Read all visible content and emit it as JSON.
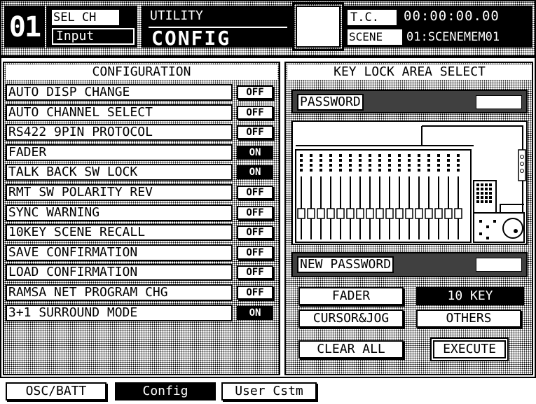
{
  "header": {
    "channel_number": "01",
    "sel_ch_label": "SEL CH",
    "sel_ch_value": "Input",
    "mode_label": "UTILITY",
    "mode_value": "CONFIG",
    "tc_label": "T.C.",
    "tc_value": "00:00:00.00",
    "scene_label": "SCENE",
    "scene_value": "01:SCENEMEM01"
  },
  "configuration": {
    "title": "CONFIGURATION",
    "items": [
      {
        "label": "AUTO DISP CHANGE",
        "state": "OFF"
      },
      {
        "label": "AUTO CHANNEL SELECT",
        "state": "OFF"
      },
      {
        "label": "RS422 9PIN PROTOCOL",
        "state": "OFF"
      },
      {
        "label": "FADER",
        "state": "ON"
      },
      {
        "label": "TALK BACK SW LOCK",
        "state": "ON"
      },
      {
        "label": "RMT SW POLARITY REV",
        "state": "OFF"
      },
      {
        "label": "SYNC WARNING",
        "state": "OFF"
      },
      {
        "label": "10KEY SCENE RECALL",
        "state": "OFF"
      },
      {
        "label": "SAVE CONFIRMATION",
        "state": "OFF"
      },
      {
        "label": "LOAD CONFIRMATION",
        "state": "OFF"
      },
      {
        "label": "RAMSA NET PROGRAM CHG",
        "state": "OFF"
      },
      {
        "label": "3+1 SURROUND MODE",
        "state": "ON"
      }
    ]
  },
  "key_lock": {
    "title": "KEY LOCK AREA SELECT",
    "password_label": "PASSWORD",
    "new_password_label": "NEW PASSWORD",
    "fader_label": "FADER",
    "ten_key_label": "10 KEY",
    "cursor_jog_label": "CURSOR&JOG",
    "others_label": "OTHERS",
    "clear_all_label": "CLEAR ALL",
    "execute_label": "EXECUTE"
  },
  "tabs": [
    "OSC/BATT",
    "Config",
    "User Cstm"
  ],
  "active_tab": "Config"
}
